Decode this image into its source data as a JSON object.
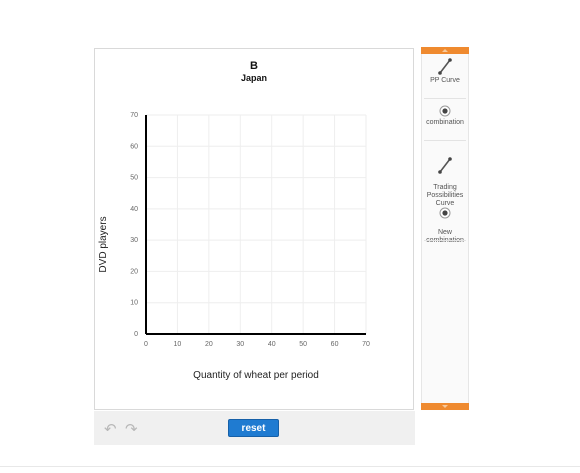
{
  "graph": {
    "title": "B",
    "subtitle": "Japan"
  },
  "chart_data": {
    "type": "scatter",
    "title": "B",
    "subtitle": "Japan",
    "xlabel": "Quantity of wheat per period",
    "ylabel": "DVD players",
    "xlim": [
      0,
      70
    ],
    "ylim": [
      0,
      70
    ],
    "xticks": [
      0,
      10,
      20,
      30,
      40,
      50,
      60,
      70
    ],
    "yticks": [
      0,
      10,
      20,
      30,
      40,
      50,
      60,
      70
    ],
    "grid": true,
    "series": []
  },
  "tools": {
    "pp_curve": "PP Curve",
    "combination": "combination",
    "trading_possibilities": "Trading\nPossibilities\nCurve",
    "new_combination": "New\ncombination"
  },
  "controls": {
    "reset_label": "reset",
    "undo_icon": "undo-icon",
    "redo_icon": "redo-icon"
  },
  "colors": {
    "accent": "#ef8a2f",
    "button": "#1f7bd1",
    "axis": "#000000",
    "grid": "#eeeeee"
  }
}
